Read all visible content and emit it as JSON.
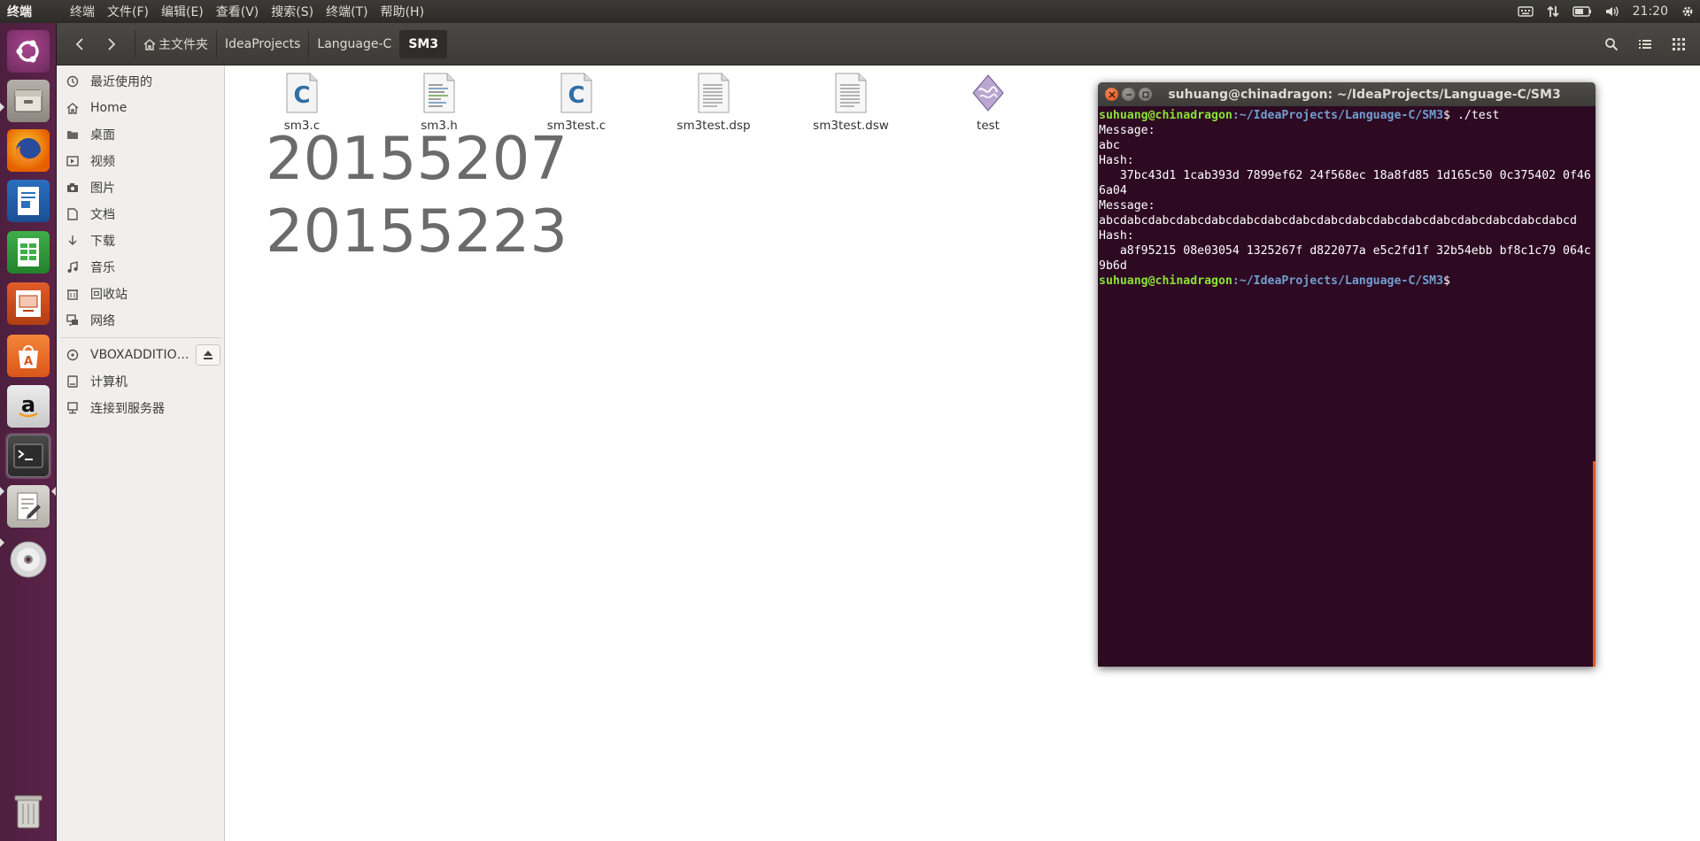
{
  "top_panel": {
    "app_title": "终端",
    "menus": [
      "终端",
      "文件(F)",
      "编辑(E)",
      "查看(V)",
      "搜索(S)",
      "终端(T)",
      "帮助(H)"
    ],
    "clock": "21:20"
  },
  "launcher": {
    "items": [
      "ubuntu-dash",
      "files",
      "firefox",
      "libreoffice-writer",
      "libreoffice-calc",
      "libreoffice-impress",
      "ubuntu-software",
      "amazon",
      "terminal",
      "text-editor",
      "dvd",
      "trash"
    ]
  },
  "file_manager": {
    "breadcrumbs": [
      "主文件夹",
      "IdeaProjects",
      "Language-C",
      "SM3"
    ],
    "active_crumb": "SM3",
    "sidebar": {
      "places": [
        "最近使用的",
        "Home",
        "桌面",
        "视频",
        "图片",
        "文档",
        "下载",
        "音乐",
        "回收站",
        "网络"
      ],
      "devices": [
        "VBOXADDITIO…",
        "计算机",
        "连接到服务器"
      ]
    },
    "files": [
      {
        "name": "sm3.c",
        "type": "c"
      },
      {
        "name": "sm3.h",
        "type": "h"
      },
      {
        "name": "sm3test.c",
        "type": "c"
      },
      {
        "name": "sm3test.dsp",
        "type": "text"
      },
      {
        "name": "sm3test.dsw",
        "type": "text"
      },
      {
        "name": "test",
        "type": "exec"
      }
    ],
    "overlay_numbers": [
      "20155207",
      "20155223"
    ]
  },
  "terminal": {
    "title": "suhuang@chinadragon: ~/IdeaProjects/Language-C/SM3",
    "prompt_user": "suhuang@chinadragon",
    "prompt_path": ":~/IdeaProjects/Language-C/SM3",
    "prompt_symbol": "$",
    "command": " ./test",
    "output": "Message:\nabc\nHash:\n   37bc43d1 1cab393d 7899ef62 24f568ec 18a8fd85 1d165c50 0c375402 0f466a04\nMessage:\nabcdabcdabcdabcdabcdabcdabcdabcdabcdabcdabcdabcdabcdabcdabcdabcdabcd\nHash:\n   a8f95215 08e03054 1325267f d822077a e5c2fd1f 32b54ebb bf8c1c79 064c9b6d"
  }
}
